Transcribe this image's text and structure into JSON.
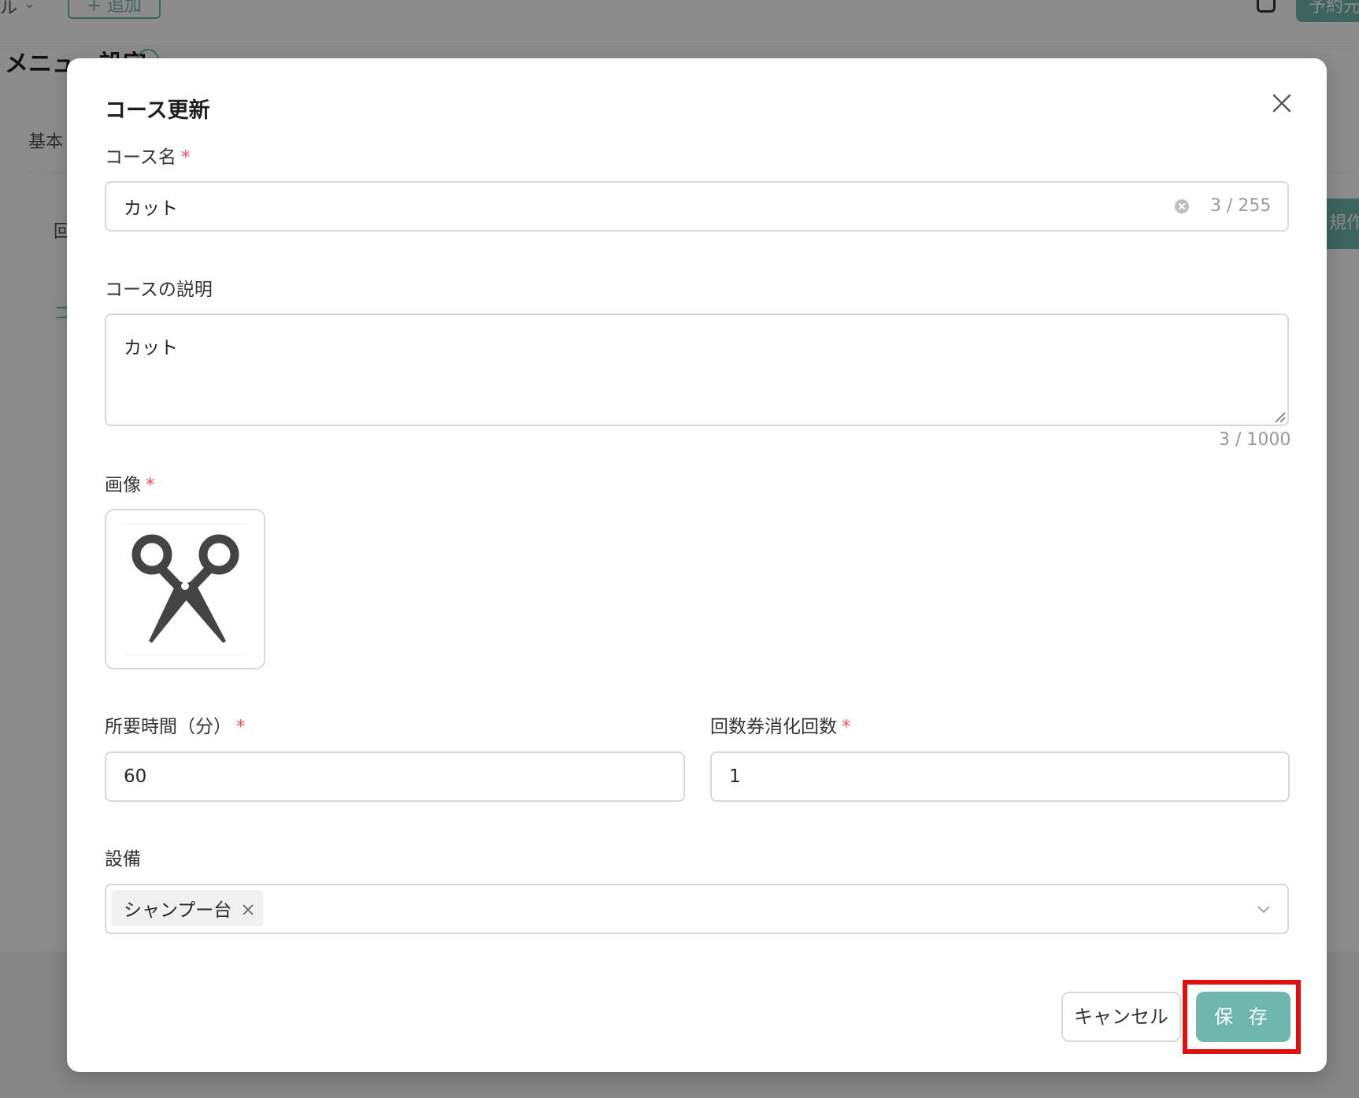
{
  "background": {
    "top_left_text": "ル",
    "add_button_label": "+ 追加",
    "reserve_button_label": "予約元",
    "page_title": "メニュー設定",
    "tab_basic": "基本",
    "side_item_1": "回",
    "side_item_2": "コ",
    "create_button_label": "規作成"
  },
  "modal": {
    "title": "コース更新",
    "course_name": {
      "label": "コース名",
      "required_mark": "*",
      "value": "カット",
      "counter": "3 / 255"
    },
    "course_description": {
      "label": "コースの説明",
      "value": "カット",
      "counter": "3 / 1000"
    },
    "image": {
      "label": "画像",
      "required_mark": "*",
      "thumbnail_icon": "scissors-icon"
    },
    "duration": {
      "label": "所要時間（分）",
      "required_mark": "*",
      "value": "60"
    },
    "ticket_count": {
      "label": "回数券消化回数",
      "required_mark": "*",
      "value": "1"
    },
    "equipment": {
      "label": "設備",
      "selected_tags": [
        "シャンプー台"
      ]
    },
    "buttons": {
      "cancel_label": "キャンセル",
      "save_label": "保 存"
    }
  },
  "colors": {
    "accent": "#6fb7ae",
    "required": "#ff4d4f",
    "highlight": "#e01010"
  }
}
